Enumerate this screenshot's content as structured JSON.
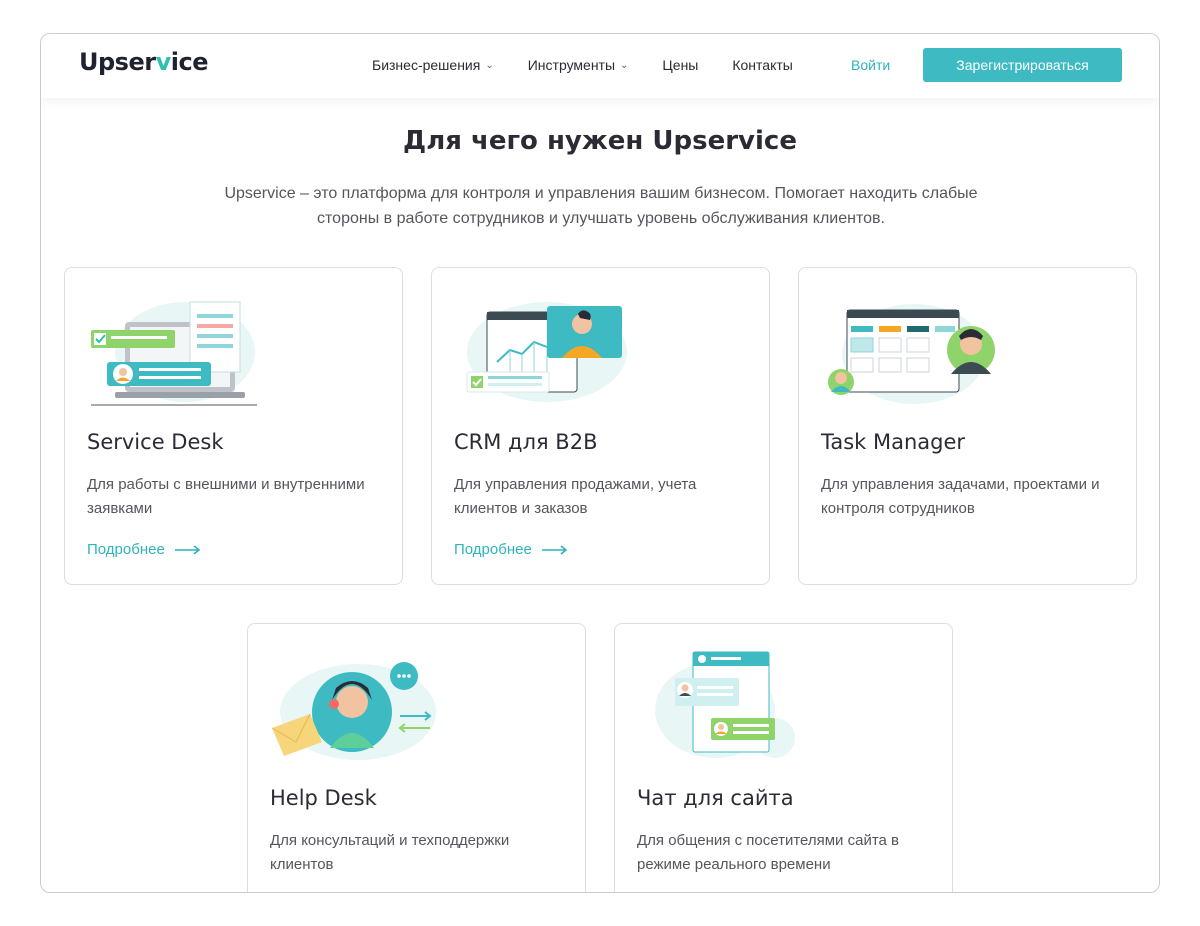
{
  "header": {
    "logo_prefix": "Upser",
    "logo_accent": "v",
    "logo_suffix": "ice",
    "nav": [
      {
        "label": "Бизнес-решения",
        "has_dropdown": true
      },
      {
        "label": "Инструменты",
        "has_dropdown": true
      },
      {
        "label": "Цены",
        "has_dropdown": false
      },
      {
        "label": "Контакты",
        "has_dropdown": false
      }
    ],
    "login": "Войти",
    "register": "Зарегистрироваться"
  },
  "hero": {
    "title": "Для чего нужен Upservice",
    "subtitle": "Upservice – это платформа для контроля и управления вашим бизнесом. Помогает находить слабые стороны в работе сотрудников и улучшать уровень обслуживания клиентов."
  },
  "cards": [
    {
      "title": "Service Desk",
      "desc": "Для работы с внешними и внутренними заявками",
      "more": "Подробнее",
      "icon": "service-desk-illustration"
    },
    {
      "title": "CRM для B2B",
      "desc": "Для управления продажами, учета клиентов и заказов",
      "more": "Подробнее",
      "icon": "crm-illustration"
    },
    {
      "title": "Task Manager",
      "desc": "Для управления задачами, проектами и контроля сотрудников",
      "more": "",
      "icon": "task-manager-illustration"
    },
    {
      "title": "Help Desk",
      "desc": "Для консультаций и техподдержки клиентов",
      "more": "",
      "icon": "help-desk-illustration"
    },
    {
      "title": "Чат для сайта",
      "desc": "Для общения с посетителями сайта в режиме реального времени",
      "more": "",
      "icon": "chat-illustration"
    }
  ],
  "colors": {
    "accent": "#3dbac2",
    "link": "#2eb4bd",
    "text": "#2b2b35",
    "muted": "#54565e",
    "green": "#8fd46b",
    "orange": "#f5a623"
  }
}
